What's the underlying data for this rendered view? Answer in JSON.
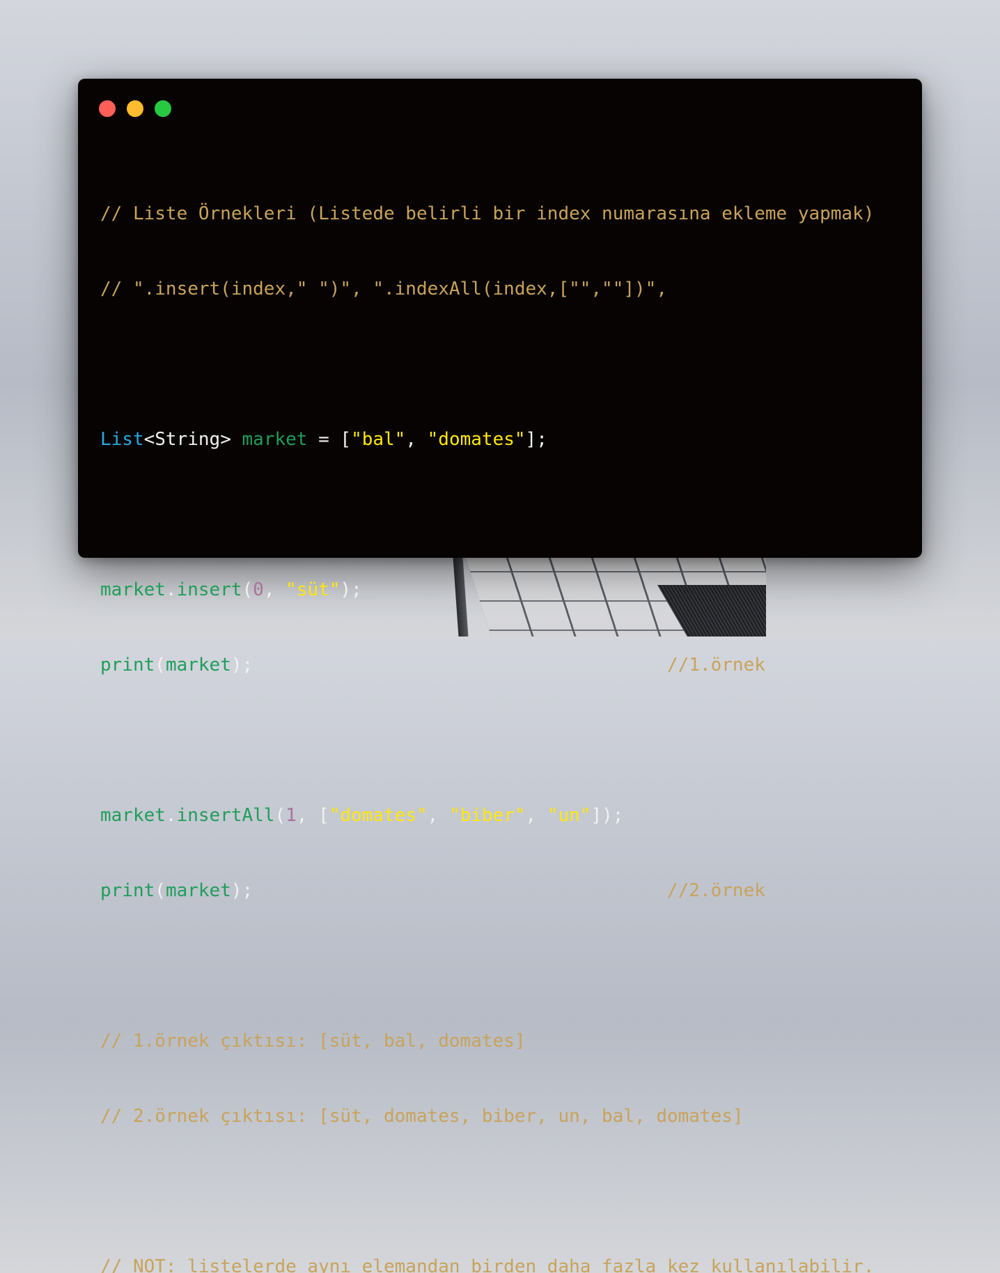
{
  "window": {
    "controls": [
      "close",
      "minimize",
      "maximize"
    ],
    "colors": {
      "close": "#ff5f57",
      "minimize": "#febc2e",
      "maximize": "#28c840",
      "background": "#070302"
    }
  },
  "code": {
    "comment1": "// Liste Örnekleri (Listede belirli bir index numarasına ekleme yapmak)",
    "comment2": "// \".insert(index,\" \")\", \".indexAll(index,[\"\",\"\"])\",",
    "decl": {
      "type_kw": "List",
      "type_param": "<String>",
      "var": "market",
      "eq": " = [",
      "s1": "\"bal\"",
      "comma": ", ",
      "s2": "\"domates\"",
      "end": "];"
    },
    "insert": {
      "obj": "market",
      "dot": ".",
      "method": "insert",
      "open": "(",
      "num": "0",
      "comma": ", ",
      "str": "\"süt\"",
      "close": ");"
    },
    "print1": {
      "fn": "print",
      "open": "(",
      "arg": "market",
      "close": ");",
      "comment": "//1.örnek"
    },
    "insertAll": {
      "obj": "market",
      "dot": ".",
      "method": "insertAll",
      "open": "(",
      "num": "1",
      "mid": ", [",
      "s1": "\"domates\"",
      "c1": ", ",
      "s2": "\"biber\"",
      "c2": ", ",
      "s3": "\"un\"",
      "close": "]);"
    },
    "print2": {
      "fn": "print",
      "open": "(",
      "arg": "market",
      "close": ");",
      "comment": "//2.örnek"
    },
    "out1": "// 1.örnek çıktısı: [süt, bal, domates]",
    "out2": "// 2.örnek çıktısı: [süt, domates, biber, un, bal, domates]",
    "note": "// NOT: listelerde aynı elemandan birden daha fazla kez kullanılabilir."
  },
  "syntax_colors": {
    "comment": "#c9a35a",
    "keyword": "#29a8e0",
    "identifier": "#1f9e5a",
    "string": "#ffe70a",
    "number": "#a9739b",
    "punctuation": "#f2f2f2"
  }
}
